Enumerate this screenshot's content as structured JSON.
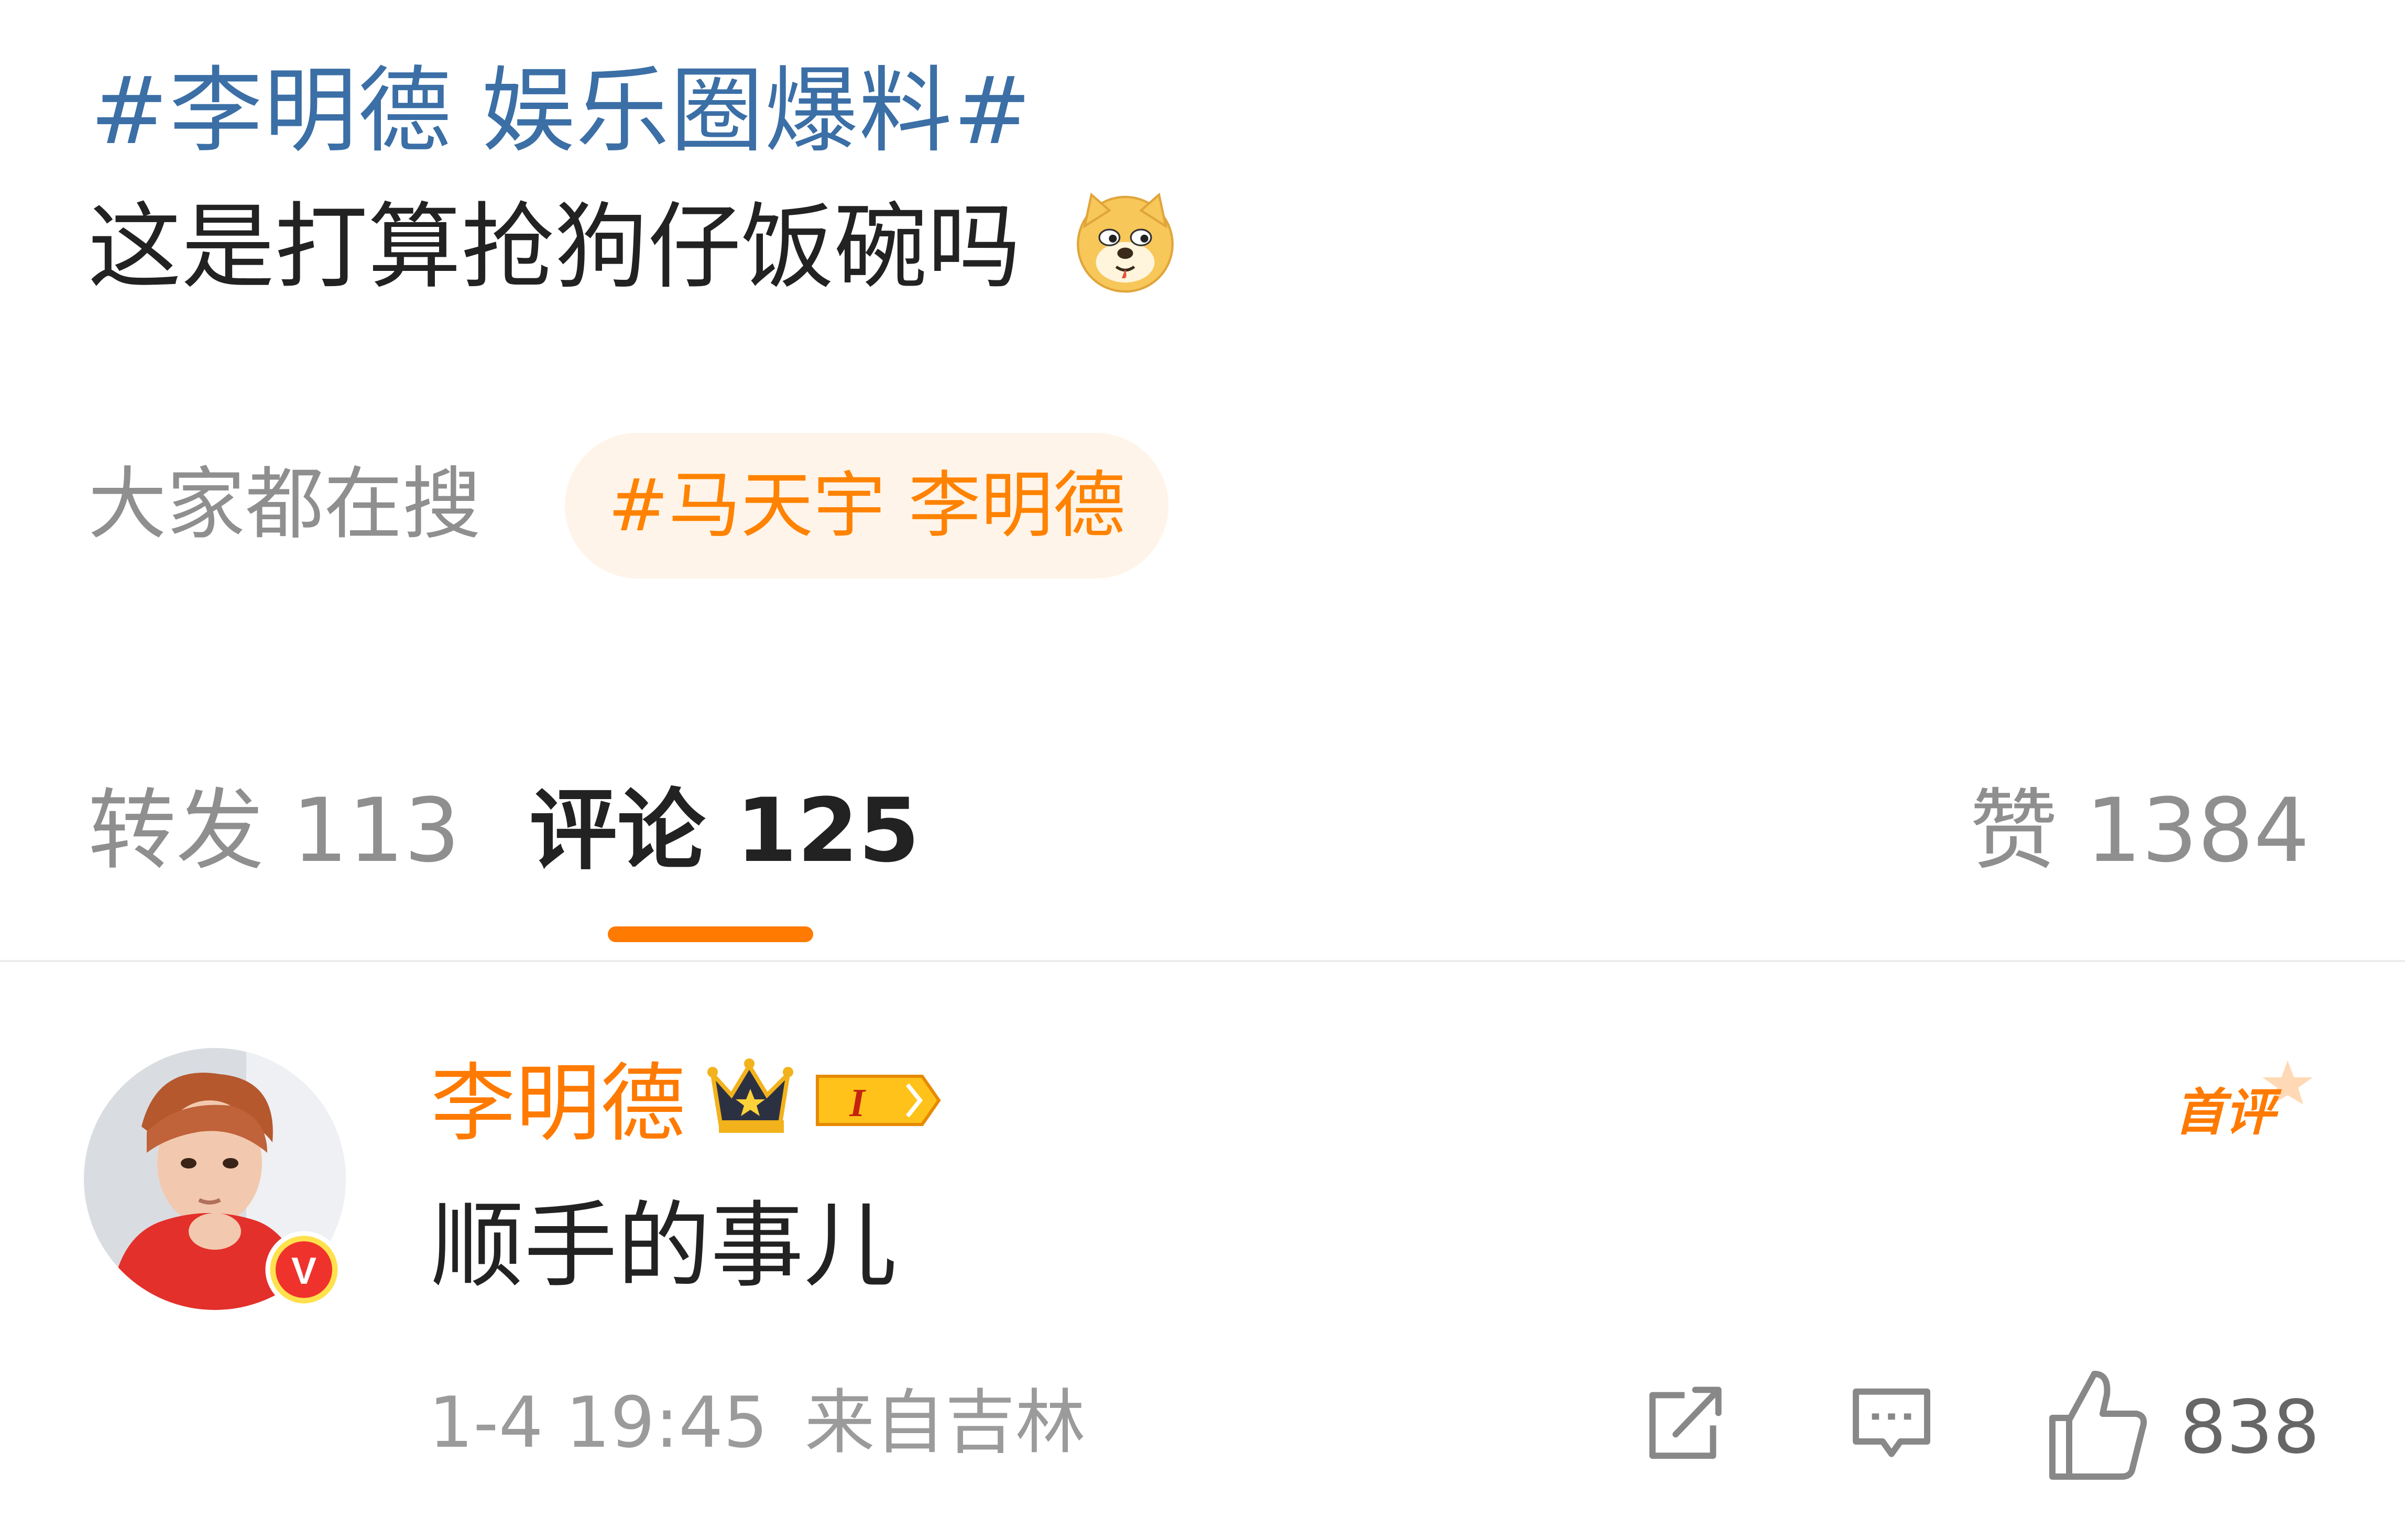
{
  "post": {
    "topic_1": "#李明德",
    "topic_2": "娱乐圈爆料#",
    "text": "这是打算抢狗仔饭碗吗",
    "emoji": "doge-emoji"
  },
  "search_bar": {
    "label": "大家都在搜",
    "chip": "#马天宇 李明德"
  },
  "tabs": {
    "repost": "转发 113",
    "comment": "评论 125",
    "like": "赞 1384"
  },
  "comment": {
    "username": "李明德",
    "badge_level": "I",
    "first_label": "首评",
    "text": "顺手的事儿",
    "date": "1-4 19:45",
    "location": "来自吉林",
    "like_count": "838",
    "verified_badge": "V"
  },
  "colors": {
    "accent": "#ff7a00",
    "topic": "#3b6fa6",
    "text": "#222222",
    "muted": "#8f8f8f"
  }
}
